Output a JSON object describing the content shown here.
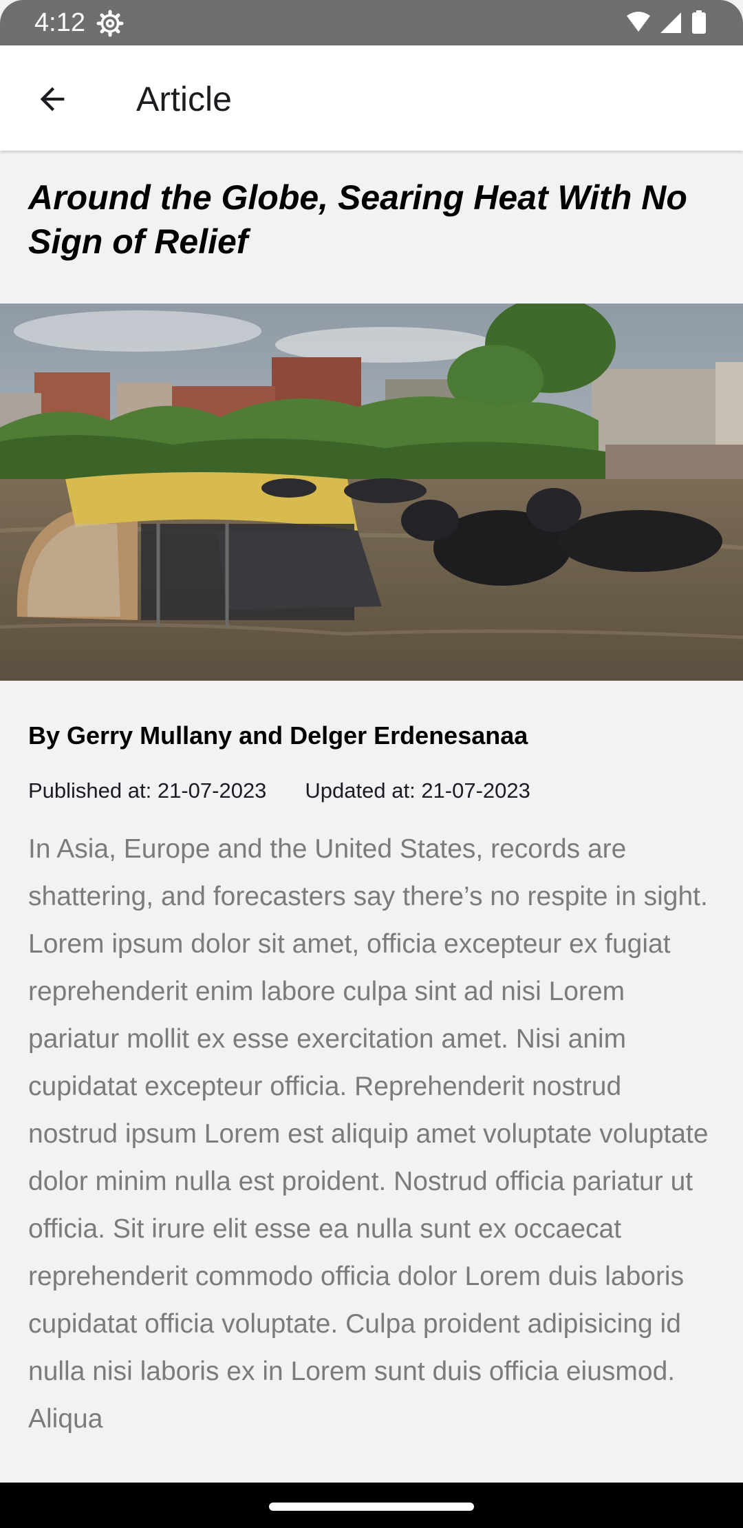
{
  "status_bar": {
    "time": "4:12",
    "icons": [
      "settings-gear-icon",
      "wifi-icon",
      "signal-icon",
      "battery-icon"
    ]
  },
  "app_bar": {
    "back_icon": "arrow-back-icon",
    "title": "Article"
  },
  "article": {
    "headline": "Around the Globe, Searing Heat With No Sign of Relief",
    "image_description": "flooded-street-with-rickshaw-and-water-buffalo",
    "byline": "By Gerry Mullany and Delger Erdenesanaa",
    "published": "Published at: 21-07-2023",
    "updated": "Updated at: 21-07-2023",
    "summary": "In Asia, Europe and the United States, records are shattering, and forecasters say there’s no respite in sight.",
    "body": "Lorem ipsum dolor sit amet, officia excepteur ex fugiat reprehenderit enim labore culpa sint ad nisi Lorem pariatur mollit ex esse exercitation amet. Nisi anim cupidatat excepteur officia. Reprehenderit nostrud nostrud ipsum Lorem est aliquip amet voluptate voluptate dolor minim nulla est proident. Nostrud officia pariatur ut officia. Sit irure elit esse ea nulla sunt ex occaecat reprehenderit commodo officia dolor Lorem duis laboris cupidatat officia voluptate. Culpa proident adipisicing id nulla nisi laboris ex in Lorem sunt duis officia eiusmod. Aliqua"
  },
  "colors": {
    "status_bar": "#6f6f6f",
    "app_bar": "#ffffff",
    "background": "#f2f1f3",
    "body_text": "#7b7b7b",
    "nav_bar": "#000000"
  }
}
